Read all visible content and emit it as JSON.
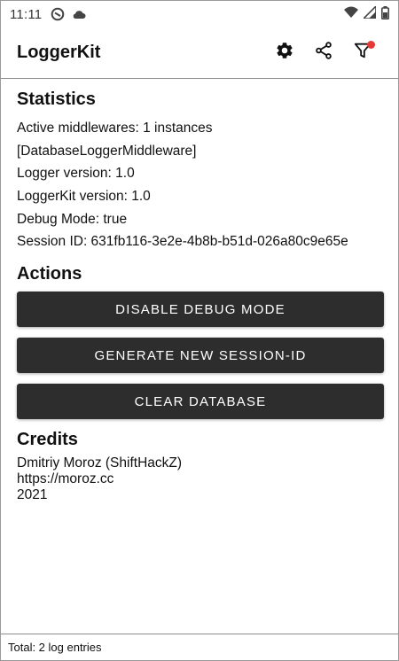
{
  "status_bar": {
    "time": "11:11",
    "left_icons": [
      "do-not-disturb-icon",
      "cloud-icon"
    ],
    "right_icons": [
      "wifi-icon",
      "signal-icon",
      "battery-icon"
    ]
  },
  "toolbar": {
    "title": "LoggerKit",
    "actions": [
      "settings-icon",
      "share-icon",
      "filter-icon"
    ],
    "badge_color": "#e53935"
  },
  "statistics": {
    "heading": "Statistics",
    "lines": [
      "Active middlewares: 1 instances",
      "[DatabaseLoggerMiddleware]",
      "Logger version: 1.0",
      "LoggerKit version: 1.0",
      "Debug Mode: true",
      "Session ID: 631fb116-3e2e-4b8b-b51d-026a80c9e65e"
    ]
  },
  "actions": {
    "heading": "Actions",
    "buttons": [
      "DISABLE DEBUG MODE",
      "GENERATE NEW SESSION-ID",
      "CLEAR DATABASE"
    ],
    "button_color": "#2d2d2d"
  },
  "credits": {
    "heading": "Credits",
    "lines": [
      "Dmitriy Moroz (ShiftHackZ)",
      "https://moroz.cc",
      "2021"
    ]
  },
  "footer": {
    "text": "Total: 2 log entries"
  }
}
